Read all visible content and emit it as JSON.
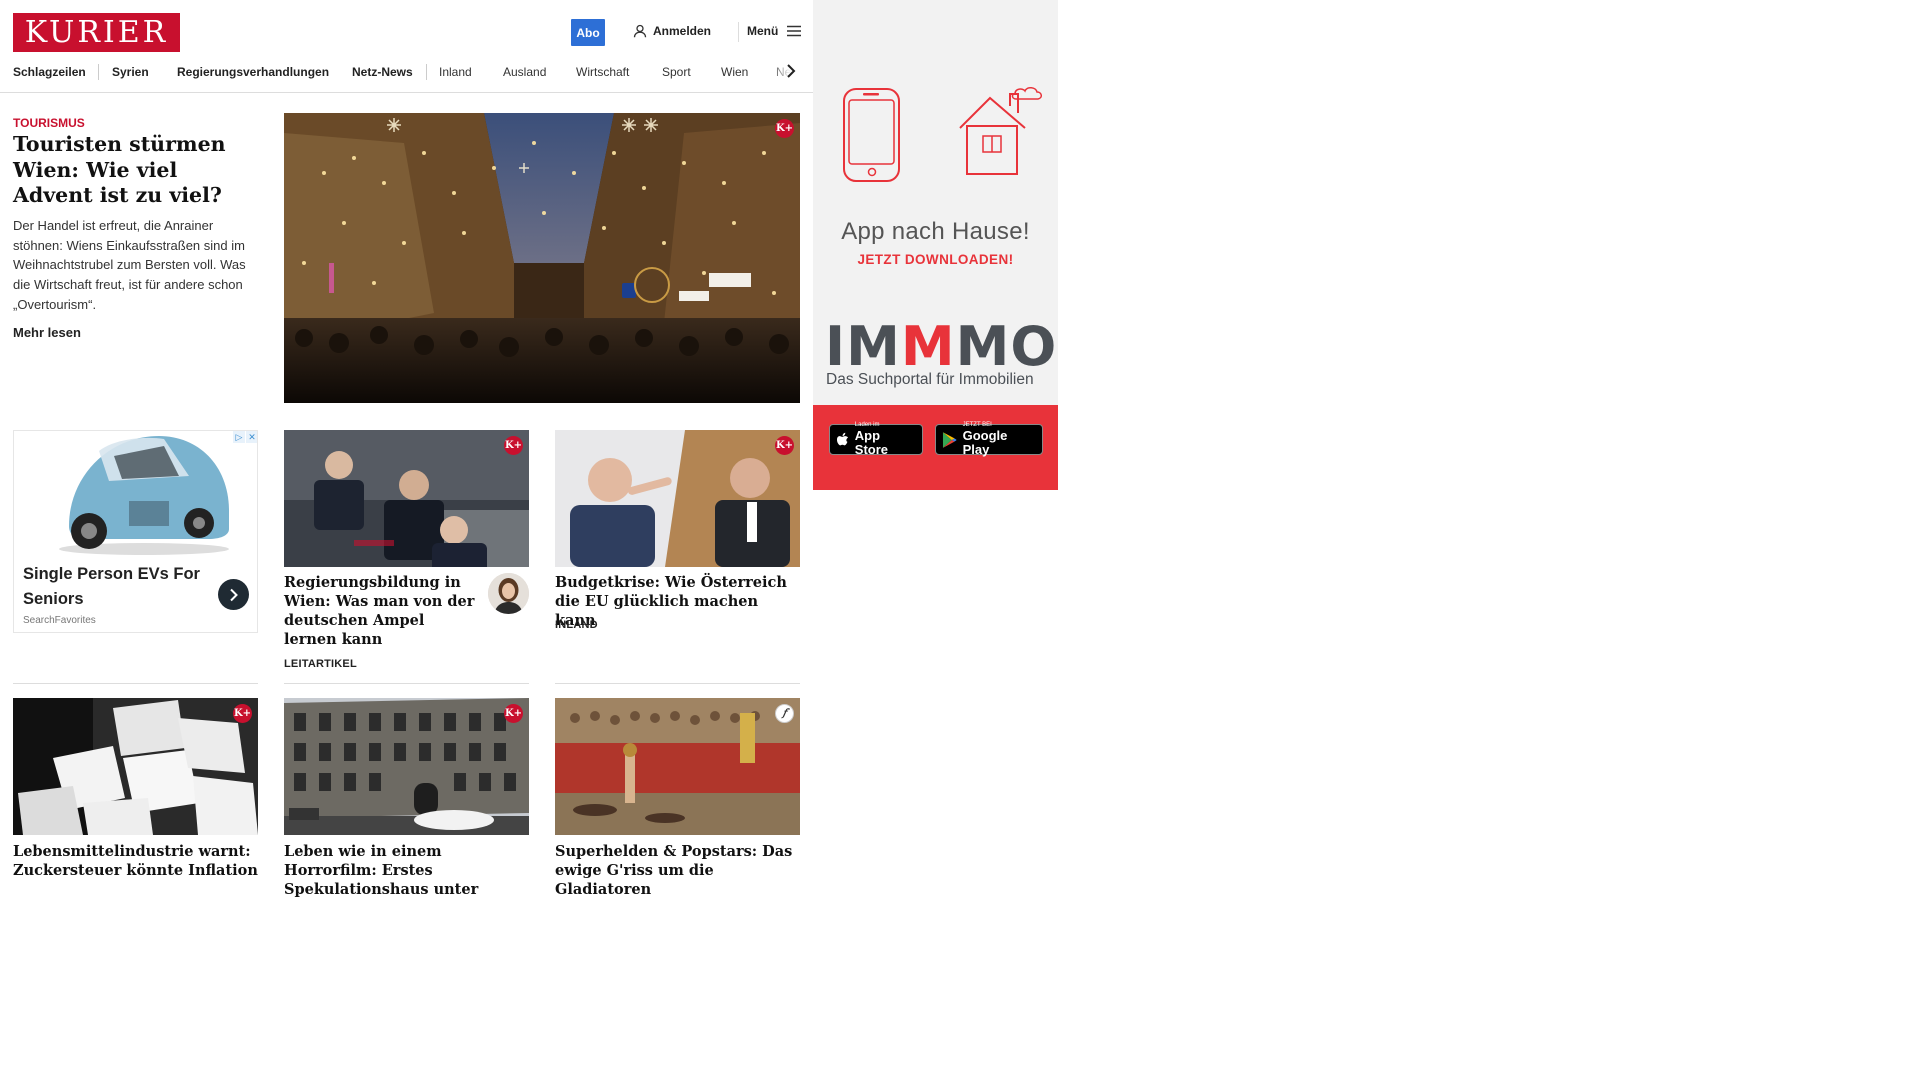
{
  "header": {
    "logo": "KURIER",
    "abo": "Abo",
    "login": "Anmelden",
    "menu": "Menü"
  },
  "nav": {
    "items": [
      "Schlagzeilen",
      "Syrien",
      "Regierungsverhandlungen",
      "Netz-News",
      "Inland",
      "Ausland",
      "Wirtschaft",
      "Sport",
      "Wien",
      "Ne"
    ]
  },
  "hero": {
    "kicker": "TOURISMUS",
    "title": "Touristen stürmen Wien: Wie viel Advent ist zu viel?",
    "teaser": "Der Handel ist erfreut, die Anrainer stöhnen: Wiens Einkaufsstraßen sind im Weihnachtstrubel zum Bersten voll. Was die Wirtschaft freut, ist für andere schon „Overtourism“.",
    "more": "Mehr lesen",
    "badge": "K+"
  },
  "ad": {
    "title": "Single Person EVs For Seniors",
    "source": "SearchFavorites",
    "choices": [
      "▷",
      "✕"
    ]
  },
  "cards": [
    {
      "title": "Regierungsbildung in Wien: Was man von der deutschen Ampel lernen kann",
      "kicker": "LEITARTIKEL",
      "badge": "K+"
    },
    {
      "title": "Budgetkrise: Wie Österreich die EU glücklich machen kann",
      "kicker": "INLAND",
      "badge": "K+"
    },
    {
      "title": "Lebensmittelindustrie warnt: Zu­ckersteuer könnte Inflation",
      "badge": "K+"
    },
    {
      "title": "Leben wie in einem Horrorfilm: Erstes Spekulationshaus unter",
      "badge": "K+"
    },
    {
      "title": "Superhelden & Popstars: Das ewige G'riss um die Gladiatoren",
      "badge": "𝑓"
    }
  ],
  "promo": {
    "headline": "App nach Hause!",
    "sub": "JETZT DOWNLOADEN!",
    "brand_a": "IM",
    "brand_m": "M",
    "brand_b": "MO",
    "brand_sub": "Das Suchportal für Immobilien",
    "appstore_small": "Laden im",
    "appstore_big": "App Store",
    "play_small": "JETZT BEI",
    "play_big": "Google Play"
  },
  "colors": {
    "brand_red": "#c8102e",
    "abo_blue": "#2d6fd6",
    "promo_red": "#e8333a"
  }
}
